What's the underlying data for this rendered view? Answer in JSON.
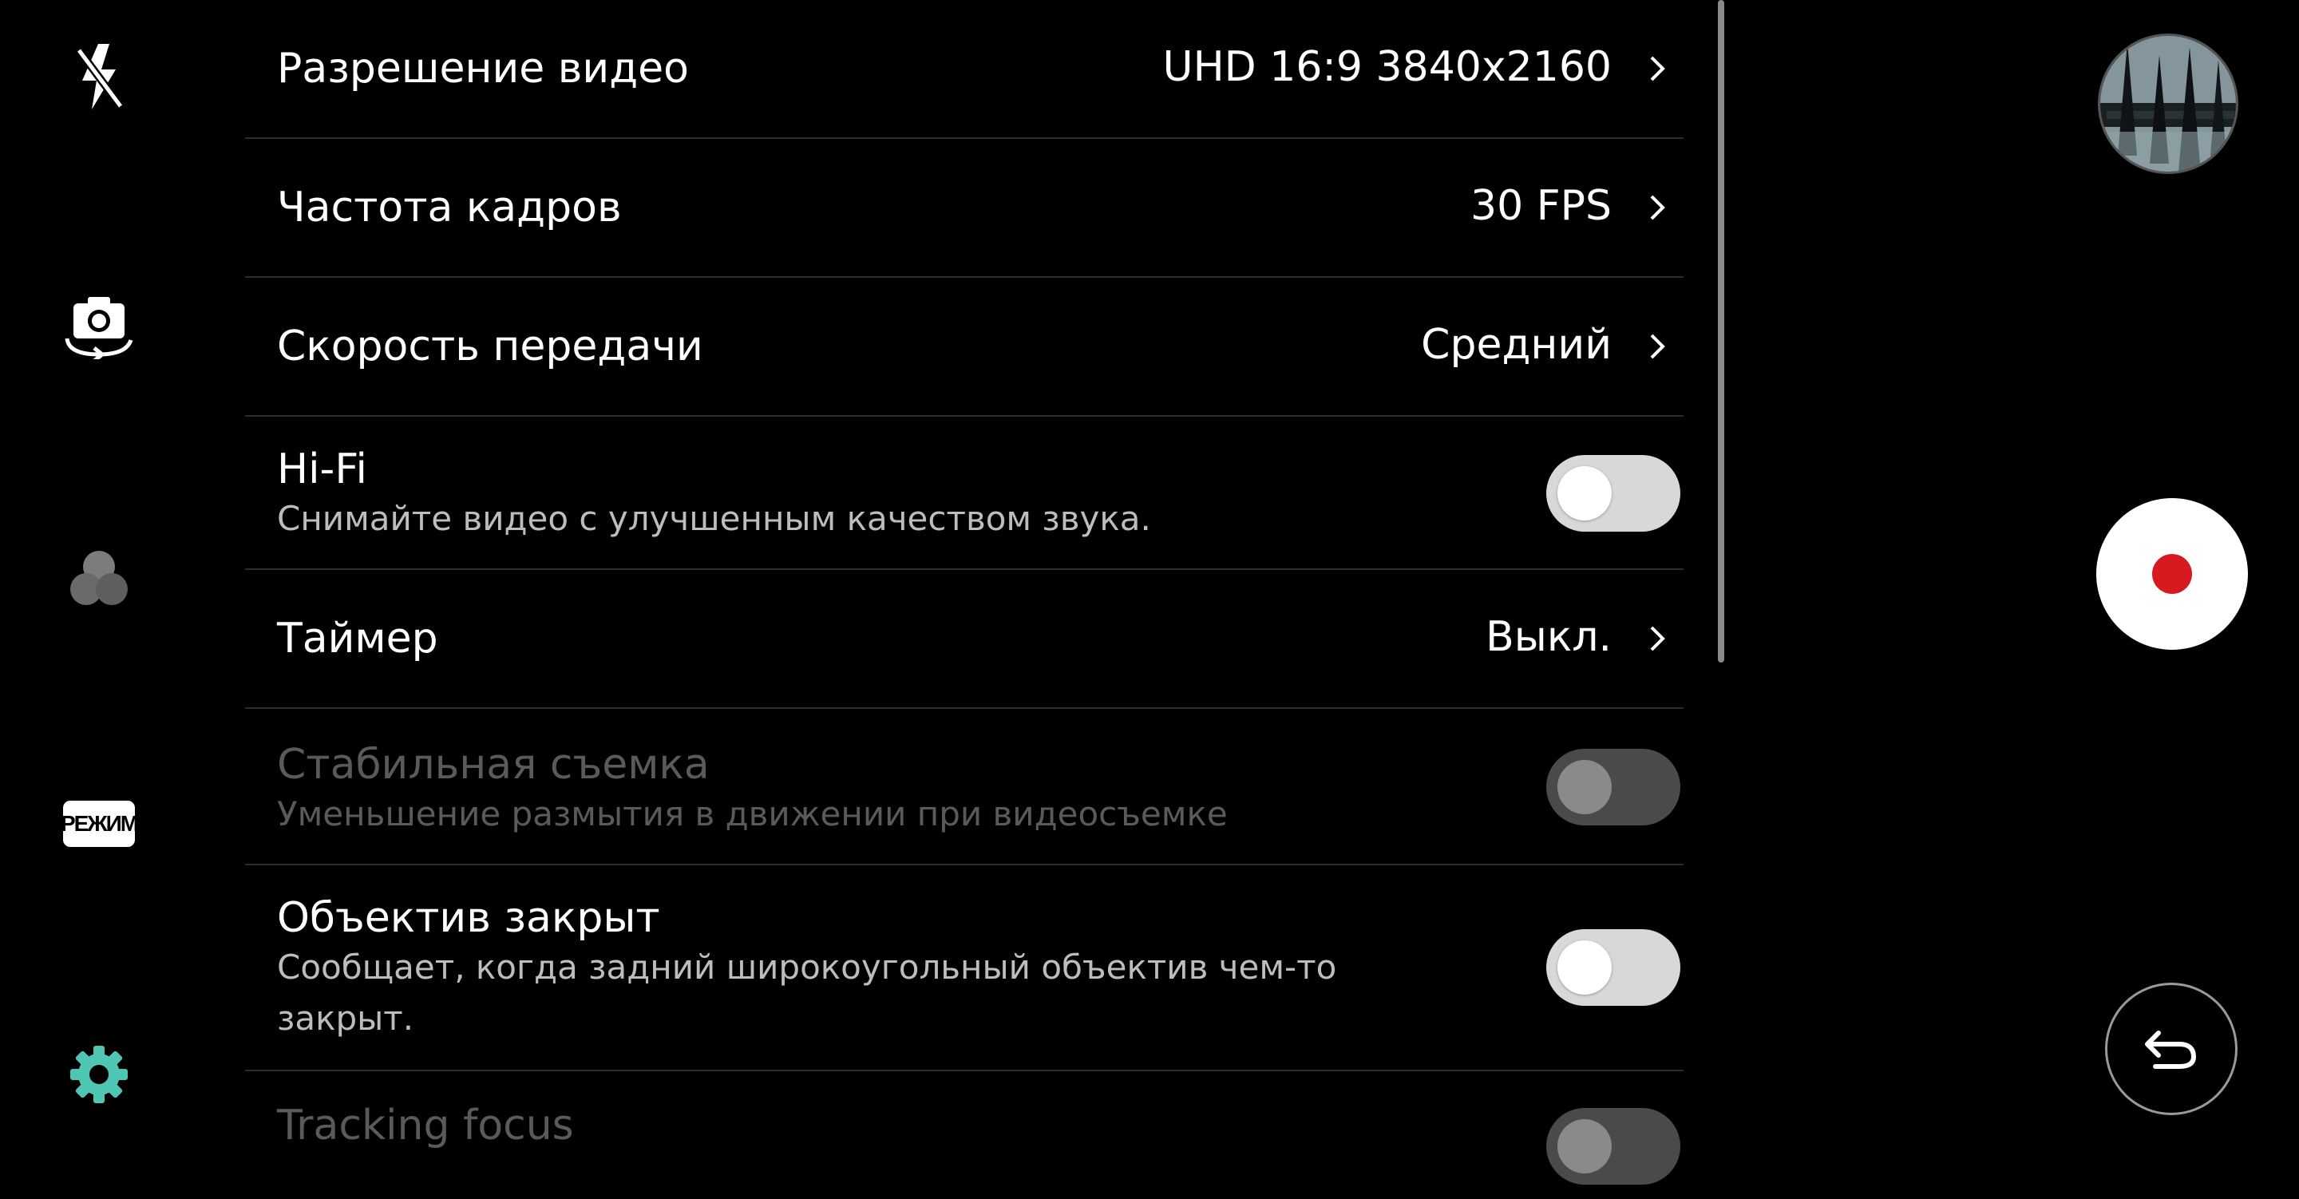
{
  "sidebar": {
    "icons": [
      "flash-off-icon",
      "switch-camera-icon",
      "filter-icon",
      "mode-icon",
      "settings-gear-icon"
    ],
    "mode_label": "РЕЖИМ",
    "accent_color": "#4fc6b3"
  },
  "settings": {
    "video_resolution": {
      "title": "Разрешение видео",
      "value": "UHD 16:9 3840x2160"
    },
    "frame_rate": {
      "title": "Частота кадров",
      "value": "30 FPS"
    },
    "bitrate": {
      "title": "Скорость передачи",
      "value": "Средний"
    },
    "hifi": {
      "title": "Hi-Fi",
      "subtitle": "Снимайте видео с улучшенным качеством звука.",
      "enabled": false
    },
    "timer": {
      "title": "Таймер",
      "value": "Выкл."
    },
    "steady": {
      "title": "Стабильная съемка",
      "subtitle": "Уменьшение размытия в движении при видеосъемке",
      "enabled": false,
      "disabled": true
    },
    "lens_blocked": {
      "title": "Объектив закрыт",
      "subtitle": "Сообщает, когда задний широкоугольный объектив чем-то закрыт.",
      "enabled": false
    },
    "tracking_focus": {
      "title": "Tracking focus",
      "enabled": false,
      "disabled": true
    }
  },
  "controls": {
    "record_color": "#d71920",
    "icons": [
      "gallery-thumbnail",
      "record-icon",
      "back-icon"
    ]
  }
}
